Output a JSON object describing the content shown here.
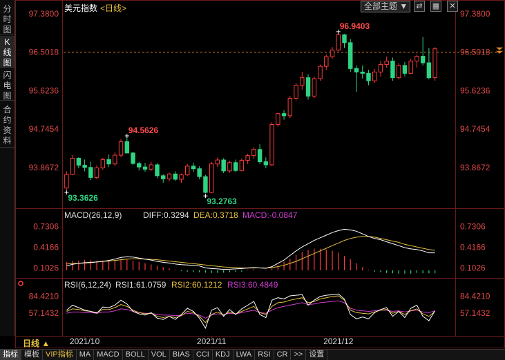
{
  "side_tabs": [
    {
      "label": "分时图",
      "active": false
    },
    {
      "label": "K线图",
      "active": true
    },
    {
      "label": "闪电图",
      "active": false
    },
    {
      "label": "合约资料",
      "active": false
    }
  ],
  "header": {
    "instrument": "美元指数",
    "period": "<日线>"
  },
  "theme_select": {
    "label": "全部主题 ▼"
  },
  "window_buttons": {
    "sync": "⇄",
    "grid": "▦",
    "close": "✕"
  },
  "period_indicator": "日线 ▲",
  "colors": {
    "up": "#ff3b3b",
    "down": "#2fd483",
    "ma": "#e8c140",
    "macd_line": "#ffffff",
    "dea_line": "#e8c140",
    "rsi1": "#ffffff",
    "rsi2": "#e8c140",
    "rsi3": "#d23cd2"
  },
  "chart_data": [
    {
      "type": "candlestick",
      "price_axis": [
        "97.3800",
        "96.5018",
        "95.6236",
        "94.7454",
        "93.8672"
      ],
      "ylim": [
        93.0,
        97.38
      ],
      "current_price_label": "96.5018",
      "annotations": {
        "high": "96.9403",
        "mid_high": "94.5626",
        "low1": "93.3626",
        "low2": "93.2763"
      },
      "x_labels": [
        "2021/10",
        "2021/11",
        "2021/12"
      ],
      "candles": [
        [
          93.4,
          93.78,
          93.36,
          93.71
        ],
        [
          93.71,
          94.15,
          93.69,
          94.08
        ],
        [
          94.08,
          94.1,
          93.85,
          93.92
        ],
        [
          93.92,
          94.05,
          93.78,
          93.87
        ],
        [
          93.87,
          94.0,
          93.58,
          93.64
        ],
        [
          93.64,
          93.92,
          93.6,
          93.86
        ],
        [
          93.86,
          94.09,
          93.82,
          94.05
        ],
        [
          94.05,
          94.16,
          93.88,
          93.95
        ],
        [
          93.95,
          94.22,
          93.9,
          94.15
        ],
        [
          94.15,
          94.52,
          94.1,
          94.46
        ],
        [
          94.46,
          94.56,
          94.32,
          94.2
        ],
        [
          94.2,
          94.23,
          93.92,
          93.96
        ],
        [
          93.96,
          94.0,
          93.8,
          93.88
        ],
        [
          93.88,
          93.97,
          93.77,
          93.83
        ],
        [
          93.83,
          94.0,
          93.79,
          93.93
        ],
        [
          93.93,
          93.97,
          93.62,
          93.68
        ],
        [
          93.68,
          93.72,
          93.52,
          93.61
        ],
        [
          93.61,
          93.75,
          93.55,
          93.72
        ],
        [
          93.72,
          93.78,
          93.56,
          93.6
        ],
        [
          93.6,
          93.73,
          93.52,
          93.7
        ],
        [
          93.7,
          93.95,
          93.67,
          93.9
        ],
        [
          93.9,
          93.98,
          93.77,
          93.84
        ],
        [
          93.84,
          93.9,
          93.6,
          93.66
        ],
        [
          93.66,
          93.7,
          93.28,
          93.3
        ],
        [
          93.3,
          94.0,
          93.28,
          93.95
        ],
        [
          93.95,
          94.1,
          93.88,
          94.04
        ],
        [
          94.04,
          94.08,
          93.74,
          93.79
        ],
        [
          93.79,
          94.02,
          93.75,
          93.98
        ],
        [
          93.98,
          94.05,
          93.76,
          93.8
        ],
        [
          93.8,
          94.08,
          93.78,
          94.03
        ],
        [
          94.03,
          94.18,
          93.95,
          94.14
        ],
        [
          94.14,
          94.33,
          94.07,
          94.28
        ],
        [
          94.28,
          94.4,
          93.95,
          94.0
        ],
        [
          94.0,
          94.1,
          93.85,
          93.93
        ],
        [
          93.93,
          94.9,
          93.9,
          94.85
        ],
        [
          94.85,
          95.12,
          94.8,
          95.1
        ],
        [
          95.1,
          95.18,
          94.96,
          95.05
        ],
        [
          95.05,
          95.5,
          95.0,
          95.45
        ],
        [
          95.45,
          95.8,
          95.4,
          95.75
        ],
        [
          95.75,
          96.05,
          95.65,
          95.92
        ],
        [
          95.92,
          96.0,
          95.42,
          95.5
        ],
        [
          95.5,
          95.95,
          95.45,
          95.9
        ],
        [
          95.9,
          96.22,
          95.85,
          96.18
        ],
        [
          96.18,
          96.45,
          96.1,
          96.4
        ],
        [
          96.4,
          96.62,
          96.35,
          96.55
        ],
        [
          96.55,
          96.94,
          96.52,
          96.9
        ],
        [
          96.9,
          96.92,
          96.6,
          96.72
        ],
        [
          96.72,
          96.8,
          96.05,
          96.13
        ],
        [
          96.13,
          96.2,
          95.6,
          96.05
        ],
        [
          96.05,
          96.2,
          95.9,
          96.02
        ],
        [
          96.02,
          96.1,
          95.75,
          95.85
        ],
        [
          95.85,
          96.12,
          95.8,
          96.05
        ],
        [
          96.05,
          96.3,
          95.95,
          96.22
        ],
        [
          96.22,
          96.4,
          96.15,
          96.3
        ],
        [
          96.3,
          96.38,
          95.85,
          95.92
        ],
        [
          95.92,
          96.25,
          95.88,
          96.2
        ],
        [
          96.2,
          96.28,
          95.95,
          96.02
        ],
        [
          96.02,
          96.35,
          96.0,
          96.3
        ],
        [
          96.3,
          96.45,
          96.15,
          96.41
        ],
        [
          96.41,
          96.85,
          96.2,
          96.26
        ],
        [
          96.26,
          96.6,
          95.88,
          95.92
        ],
        [
          95.92,
          96.62,
          95.85,
          96.58
        ]
      ]
    },
    {
      "type": "bar",
      "name": "MACD",
      "header": {
        "main": "MACD(26,12,9)",
        "diff": "DIFF:0.3294",
        "dea": "DEA:0.3718",
        "macd": "MACD:-0.0847"
      },
      "axis_labels": [
        "0.7306",
        "0.4166",
        "0.1026"
      ],
      "ylim": [
        0.0,
        0.8
      ],
      "baseline": 0.063,
      "diff": [
        0.13,
        0.155,
        0.17,
        0.18,
        0.185,
        0.19,
        0.2,
        0.215,
        0.235,
        0.26,
        0.27,
        0.265,
        0.25,
        0.235,
        0.22,
        0.2,
        0.185,
        0.175,
        0.16,
        0.15,
        0.145,
        0.14,
        0.13,
        0.1,
        0.09,
        0.085,
        0.078,
        0.08,
        0.085,
        0.09,
        0.1,
        0.105,
        0.1,
        0.095,
        0.12,
        0.17,
        0.22,
        0.29,
        0.36,
        0.42,
        0.47,
        0.52,
        0.56,
        0.6,
        0.64,
        0.67,
        0.69,
        0.68,
        0.66,
        0.62,
        0.58,
        0.55,
        0.53,
        0.5,
        0.47,
        0.44,
        0.41,
        0.39,
        0.38,
        0.36,
        0.33,
        0.33
      ],
      "dea": [
        0.16,
        0.165,
        0.17,
        0.175,
        0.18,
        0.19,
        0.2,
        0.205,
        0.215,
        0.225,
        0.235,
        0.24,
        0.24,
        0.235,
        0.23,
        0.225,
        0.215,
        0.205,
        0.195,
        0.185,
        0.175,
        0.165,
        0.155,
        0.145,
        0.135,
        0.125,
        0.115,
        0.11,
        0.105,
        0.1,
        0.098,
        0.1,
        0.1,
        0.098,
        0.105,
        0.12,
        0.14,
        0.17,
        0.2,
        0.24,
        0.28,
        0.32,
        0.36,
        0.4,
        0.44,
        0.48,
        0.52,
        0.55,
        0.57,
        0.58,
        0.58,
        0.57,
        0.55,
        0.53,
        0.51,
        0.49,
        0.46,
        0.44,
        0.42,
        0.4,
        0.38,
        0.37
      ],
      "hist": [
        0.13,
        0.14,
        0.15,
        0.16,
        0.155,
        0.15,
        0.15,
        0.155,
        0.16,
        0.17,
        0.165,
        0.15,
        0.13,
        0.11,
        0.09,
        0.07,
        0.05,
        0.03,
        0.01,
        -0.01,
        -0.02,
        -0.025,
        -0.03,
        -0.035,
        -0.04,
        -0.04,
        -0.035,
        -0.03,
        -0.025,
        -0.02,
        0.01,
        0.02,
        0.01,
        0.01,
        0.03,
        0.08,
        0.13,
        0.18,
        0.24,
        0.28,
        0.31,
        0.33,
        0.33,
        0.32,
        0.3,
        0.27,
        0.22,
        0.17,
        0.11,
        0.05,
        0.01,
        -0.02,
        -0.03,
        -0.04,
        -0.045,
        -0.05,
        -0.05,
        -0.05,
        -0.04,
        -0.045,
        -0.045,
        -0.045
      ]
    },
    {
      "type": "line",
      "name": "RSI",
      "header": {
        "main": "RSI(6,12,24)",
        "rsi1": "RSI1:61.0759",
        "rsi2": "RSI2:60.1212",
        "rsi3": "RSI3:60.4849"
      },
      "axis_labels": [
        "84.4210",
        "57.1432"
      ],
      "ylim": [
        25.0,
        95.0
      ],
      "rsi1": [
        62,
        70,
        66,
        62,
        60,
        57,
        67,
        66,
        70,
        78,
        72,
        60,
        56,
        54,
        58,
        49,
        47,
        52,
        47,
        55,
        65,
        60,
        49,
        33,
        62,
        66,
        52,
        63,
        55,
        64,
        70,
        76,
        55,
        50,
        78,
        82,
        80,
        85,
        86,
        87,
        70,
        78,
        84,
        86,
        87,
        88,
        80,
        55,
        48,
        51,
        48,
        58,
        63,
        66,
        52,
        60,
        50,
        65,
        70,
        52,
        45,
        61
      ],
      "rsi2": [
        60,
        64,
        63,
        61,
        60,
        58,
        63,
        63,
        66,
        71,
        68,
        62,
        58,
        56,
        57,
        52,
        50,
        52,
        50,
        53,
        60,
        58,
        52,
        42,
        55,
        59,
        54,
        59,
        56,
        60,
        64,
        68,
        58,
        55,
        68,
        74,
        75,
        78,
        80,
        82,
        74,
        76,
        80,
        82,
        84,
        85,
        78,
        62,
        58,
        57,
        56,
        59,
        62,
        63,
        57,
        60,
        55,
        61,
        64,
        56,
        52,
        60
      ],
      "rsi3": [
        57,
        59,
        59,
        58,
        58,
        57,
        59,
        59,
        61,
        64,
        63,
        60,
        58,
        57,
        57,
        55,
        54,
        54,
        53,
        54,
        57,
        56,
        54,
        49,
        54,
        56,
        55,
        57,
        56,
        58,
        60,
        62,
        58,
        57,
        62,
        66,
        68,
        70,
        72,
        74,
        71,
        72,
        74,
        75,
        76,
        77,
        74,
        65,
        62,
        61,
        60,
        61,
        62,
        62,
        60,
        61,
        59,
        61,
        62,
        59,
        58,
        61
      ]
    }
  ],
  "bottom_tabs": [
    {
      "label": "指标",
      "active": true,
      "vip": false
    },
    {
      "label": "模板",
      "active": false,
      "vip": false
    },
    {
      "label": "VIP指标",
      "active": false,
      "vip": true
    },
    {
      "label": "MA",
      "active": false,
      "vip": false
    },
    {
      "label": "MACD",
      "active": false,
      "vip": false
    },
    {
      "label": "BOLL",
      "active": false,
      "vip": false
    },
    {
      "label": "VOL",
      "active": false,
      "vip": false
    },
    {
      "label": "BIAS",
      "active": false,
      "vip": false
    },
    {
      "label": "CCI",
      "active": false,
      "vip": false
    },
    {
      "label": "KDJ",
      "active": false,
      "vip": false
    },
    {
      "label": "LWA",
      "active": false,
      "vip": false
    },
    {
      "label": "RSI",
      "active": false,
      "vip": false
    },
    {
      "label": "CR",
      "active": false,
      "vip": false
    },
    {
      "label": ">>",
      "active": false,
      "vip": false
    },
    {
      "label": "设置",
      "active": false,
      "vip": false
    }
  ]
}
